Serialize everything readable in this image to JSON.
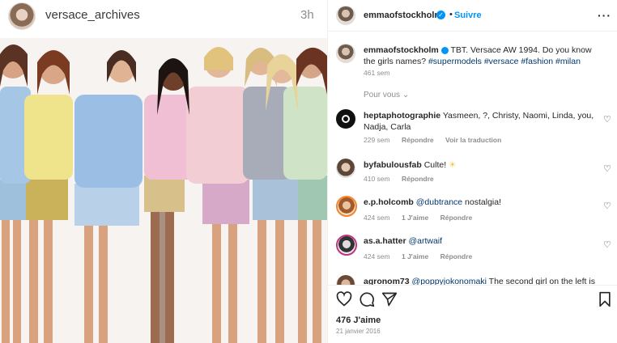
{
  "post": {
    "source_user": "versace_archives",
    "source_time": "3h",
    "author": "emmaofstockholm",
    "verified_mark": "✓",
    "separator": "•",
    "follow_label": "Suivre",
    "more_icon": "more-dots-icon",
    "more_label": "···"
  },
  "caption": {
    "user": "emmaofstockholm",
    "text": "TBT. Versace AW 1994. Do you know the girls names? ",
    "tags": "#supermodels #versace #fashion #milan",
    "age": "461 sem"
  },
  "for_you_label": "Pour vous",
  "comments": [
    {
      "user": "heptaphotographie",
      "text": "Yasmeen, ?, Christy, Naomi, Linda, you, Nadja, Carla",
      "mention": "",
      "age": "229 sem",
      "likes": "",
      "reply": "Répondre",
      "translate": "Voir la traduction"
    },
    {
      "user": "byfabulousfab",
      "text": "Culte! ",
      "emoji": "☀",
      "mention": "",
      "age": "410 sem",
      "likes": "",
      "reply": "Répondre",
      "translate": ""
    },
    {
      "user": "e.p.holcomb",
      "text": " nostalgia!",
      "mention": "@dubtrance",
      "age": "424 sem",
      "likes": "1 J'aime",
      "reply": "Répondre",
      "translate": ""
    },
    {
      "user": "as.a.hatter",
      "text": "",
      "mention": "@artwaif",
      "age": "424 sem",
      "likes": "1 J'aime",
      "reply": "Répondre",
      "translate": ""
    },
    {
      "user": "agronom73",
      "text": " The second girl on the left is",
      "mention": "@poppyjokonomaki",
      "age": "",
      "likes": "",
      "reply": "",
      "translate": ""
    }
  ],
  "footer": {
    "likes": "476 J'aime",
    "date": "21 janvier 2016"
  },
  "colors": {
    "accent": "#0095f6",
    "tag": "#00376b",
    "muted": "#8e8e8e"
  }
}
